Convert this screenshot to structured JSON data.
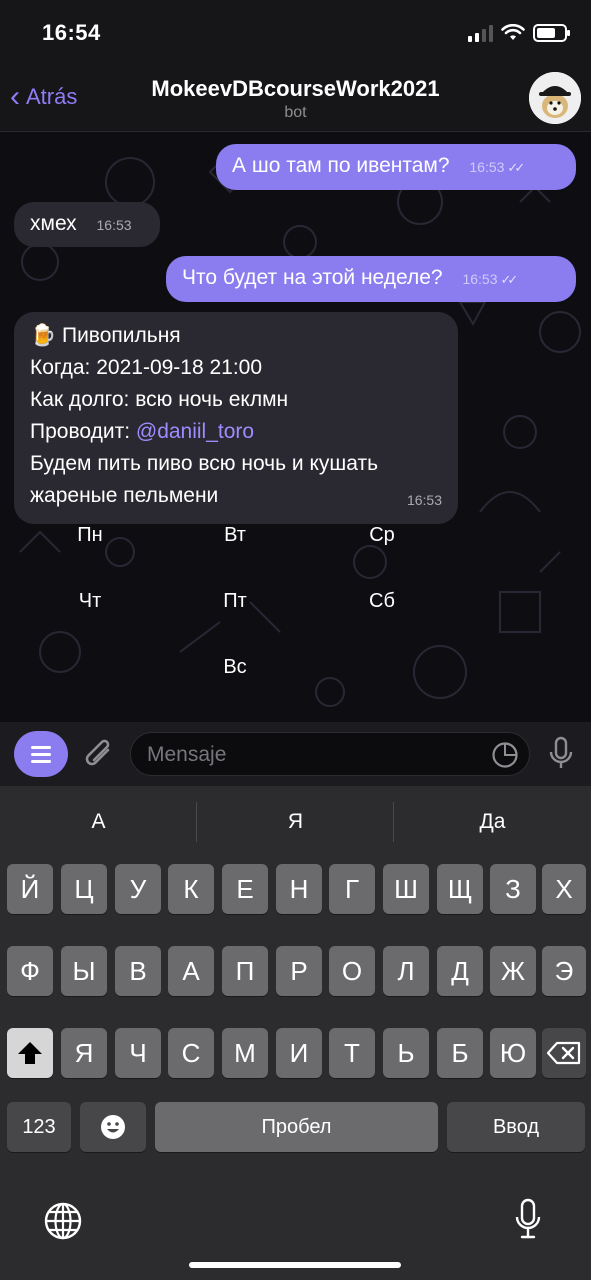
{
  "status_bar": {
    "time": "16:54"
  },
  "header": {
    "back_label": "Atrás",
    "title": "MokeevDBcourseWork2021",
    "subtitle": "bot"
  },
  "messages": [
    {
      "direction": "out",
      "text": "А шо там по ивентам?",
      "time": "16:53"
    },
    {
      "direction": "in",
      "text": "хмех",
      "time": "16:53"
    },
    {
      "direction": "out",
      "text": "Что будет на этой неделе?",
      "time": "16:53"
    },
    {
      "direction": "in",
      "lines": {
        "title": "🍺 Пивопильня",
        "when": "Когда: 2021-09-18 21:00",
        "duration": "Как долго: всю ночь еклмн",
        "host_prefix": "Проводит: ",
        "host_link": "@daniil_toro",
        "desc1": "Будем пить пиво всю ночь и кушать",
        "desc2": "жареные пельмени"
      },
      "time": "16:53"
    }
  ],
  "bot_keyboard": [
    "Пн",
    "Вт",
    "Ср",
    "Чт",
    "Пт",
    "Сб",
    "Вс"
  ],
  "composer": {
    "placeholder": "Mensaje"
  },
  "keyboard": {
    "suggestions": [
      "А",
      "Я",
      "Да"
    ],
    "row1": [
      "Й",
      "Ц",
      "У",
      "К",
      "Е",
      "Н",
      "Г",
      "Ш",
      "Щ",
      "З",
      "Х"
    ],
    "row2": [
      "Ф",
      "Ы",
      "В",
      "А",
      "П",
      "Р",
      "О",
      "Л",
      "Д",
      "Ж",
      "Э"
    ],
    "row3": [
      "Я",
      "Ч",
      "С",
      "М",
      "И",
      "Т",
      "Ь",
      "Б",
      "Ю"
    ],
    "numbers_label": "123",
    "space_label": "Пробел",
    "return_label": "Ввод"
  },
  "colors": {
    "accent": "#8b7cf0",
    "link": "#9e8cff",
    "incoming": "#2a2830",
    "outgoing": "#8b7cf0"
  },
  "icons": [
    "back-chevron-icon",
    "avatar-bot",
    "menu-icon",
    "attach-icon",
    "sticker-icon",
    "mic-icon",
    "shift-icon",
    "backspace-icon",
    "emoji-icon",
    "globe-icon",
    "dictation-icon"
  ]
}
